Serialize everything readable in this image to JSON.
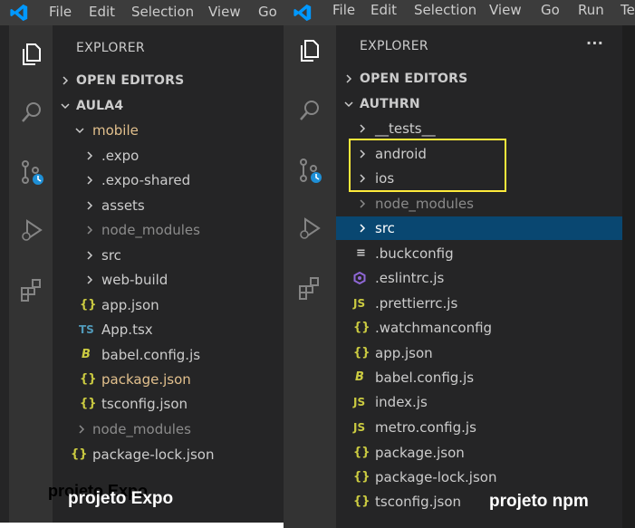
{
  "left": {
    "menu": [
      "File",
      "Edit",
      "Selection",
      "View",
      "Go"
    ],
    "explorer_title": "EXPLORER",
    "open_editors": "OPEN EDITORS",
    "root": "AULA4",
    "mobile": "mobile",
    "items": [
      {
        "label": ".expo"
      },
      {
        "label": ".expo-shared"
      },
      {
        "label": "assets"
      },
      {
        "label": "node_modules"
      },
      {
        "label": "src"
      },
      {
        "label": "web-build"
      },
      {
        "label": "app.json",
        "icon": "{}"
      },
      {
        "label": "App.tsx",
        "icon": "TS"
      },
      {
        "label": "babel.config.js",
        "icon": "B"
      },
      {
        "label": "package.json",
        "icon": "{}"
      },
      {
        "label": "tsconfig.json",
        "icon": "{}"
      },
      {
        "label": "node_modules"
      },
      {
        "label": "package-lock.json",
        "icon": "{}"
      }
    ],
    "caption_shadow": "projeto Expo",
    "caption": "projeto Expo"
  },
  "right": {
    "menu": [
      "File",
      "Edit",
      "Selection",
      "View",
      "Go",
      "Run",
      "Te"
    ],
    "explorer_title": "EXPLORER",
    "more": "···",
    "open_editors": "OPEN EDITORS",
    "root": "AUTHRN",
    "items": [
      {
        "label": "__tests__"
      },
      {
        "label": "android"
      },
      {
        "label": "ios"
      },
      {
        "label": "node_modules"
      },
      {
        "label": "src"
      },
      {
        "label": ".buckconfig",
        "icon": "≡"
      },
      {
        "label": ".eslintrc.js",
        "icon": "eslint"
      },
      {
        "label": ".prettierrc.js",
        "icon": "JS"
      },
      {
        "label": ".watchmanconfig",
        "icon": "{}"
      },
      {
        "label": "app.json",
        "icon": "{}"
      },
      {
        "label": "babel.config.js",
        "icon": "B"
      },
      {
        "label": "index.js",
        "icon": "JS"
      },
      {
        "label": "metro.config.js",
        "icon": "JS"
      },
      {
        "label": "package.json",
        "icon": "{}"
      },
      {
        "label": "package-lock.json",
        "icon": "{}"
      },
      {
        "label": "tsconfig.json",
        "icon": "{}"
      }
    ],
    "caption": "projeto npm"
  },
  "colors": {
    "json_icon": "#cbcb41",
    "ts_icon": "#519aba",
    "js_icon": "#cbcb41",
    "babel_icon": "#cbcb41",
    "eslint_icon": "#8f67d6",
    "selection": "#094771",
    "highlight": "#ffeb3b",
    "modified_text": "#e2c08d"
  }
}
